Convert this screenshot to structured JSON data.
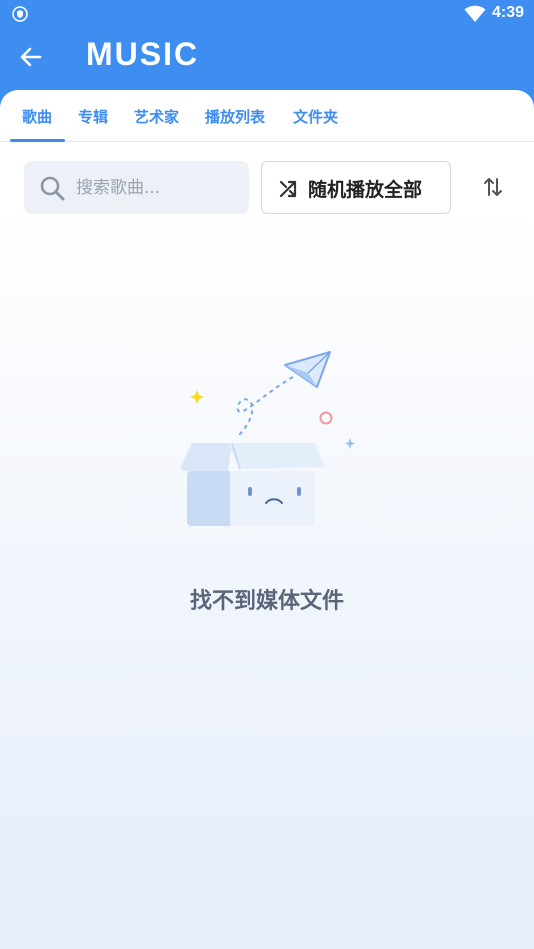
{
  "status_bar": {
    "time": "4:39"
  },
  "app_bar": {
    "title": "MUSIC"
  },
  "tabs": [
    {
      "label": "歌曲"
    },
    {
      "label": "专辑"
    },
    {
      "label": "艺术家"
    },
    {
      "label": "播放列表"
    },
    {
      "label": "文件夹"
    }
  ],
  "toolbar": {
    "search_placeholder": "搜索歌曲...",
    "shuffle_label": "随机播放全部"
  },
  "empty_state": {
    "message": "找不到媒体文件"
  },
  "colors": {
    "accent": "#3d8ef0",
    "text_muted": "#5b6579"
  }
}
